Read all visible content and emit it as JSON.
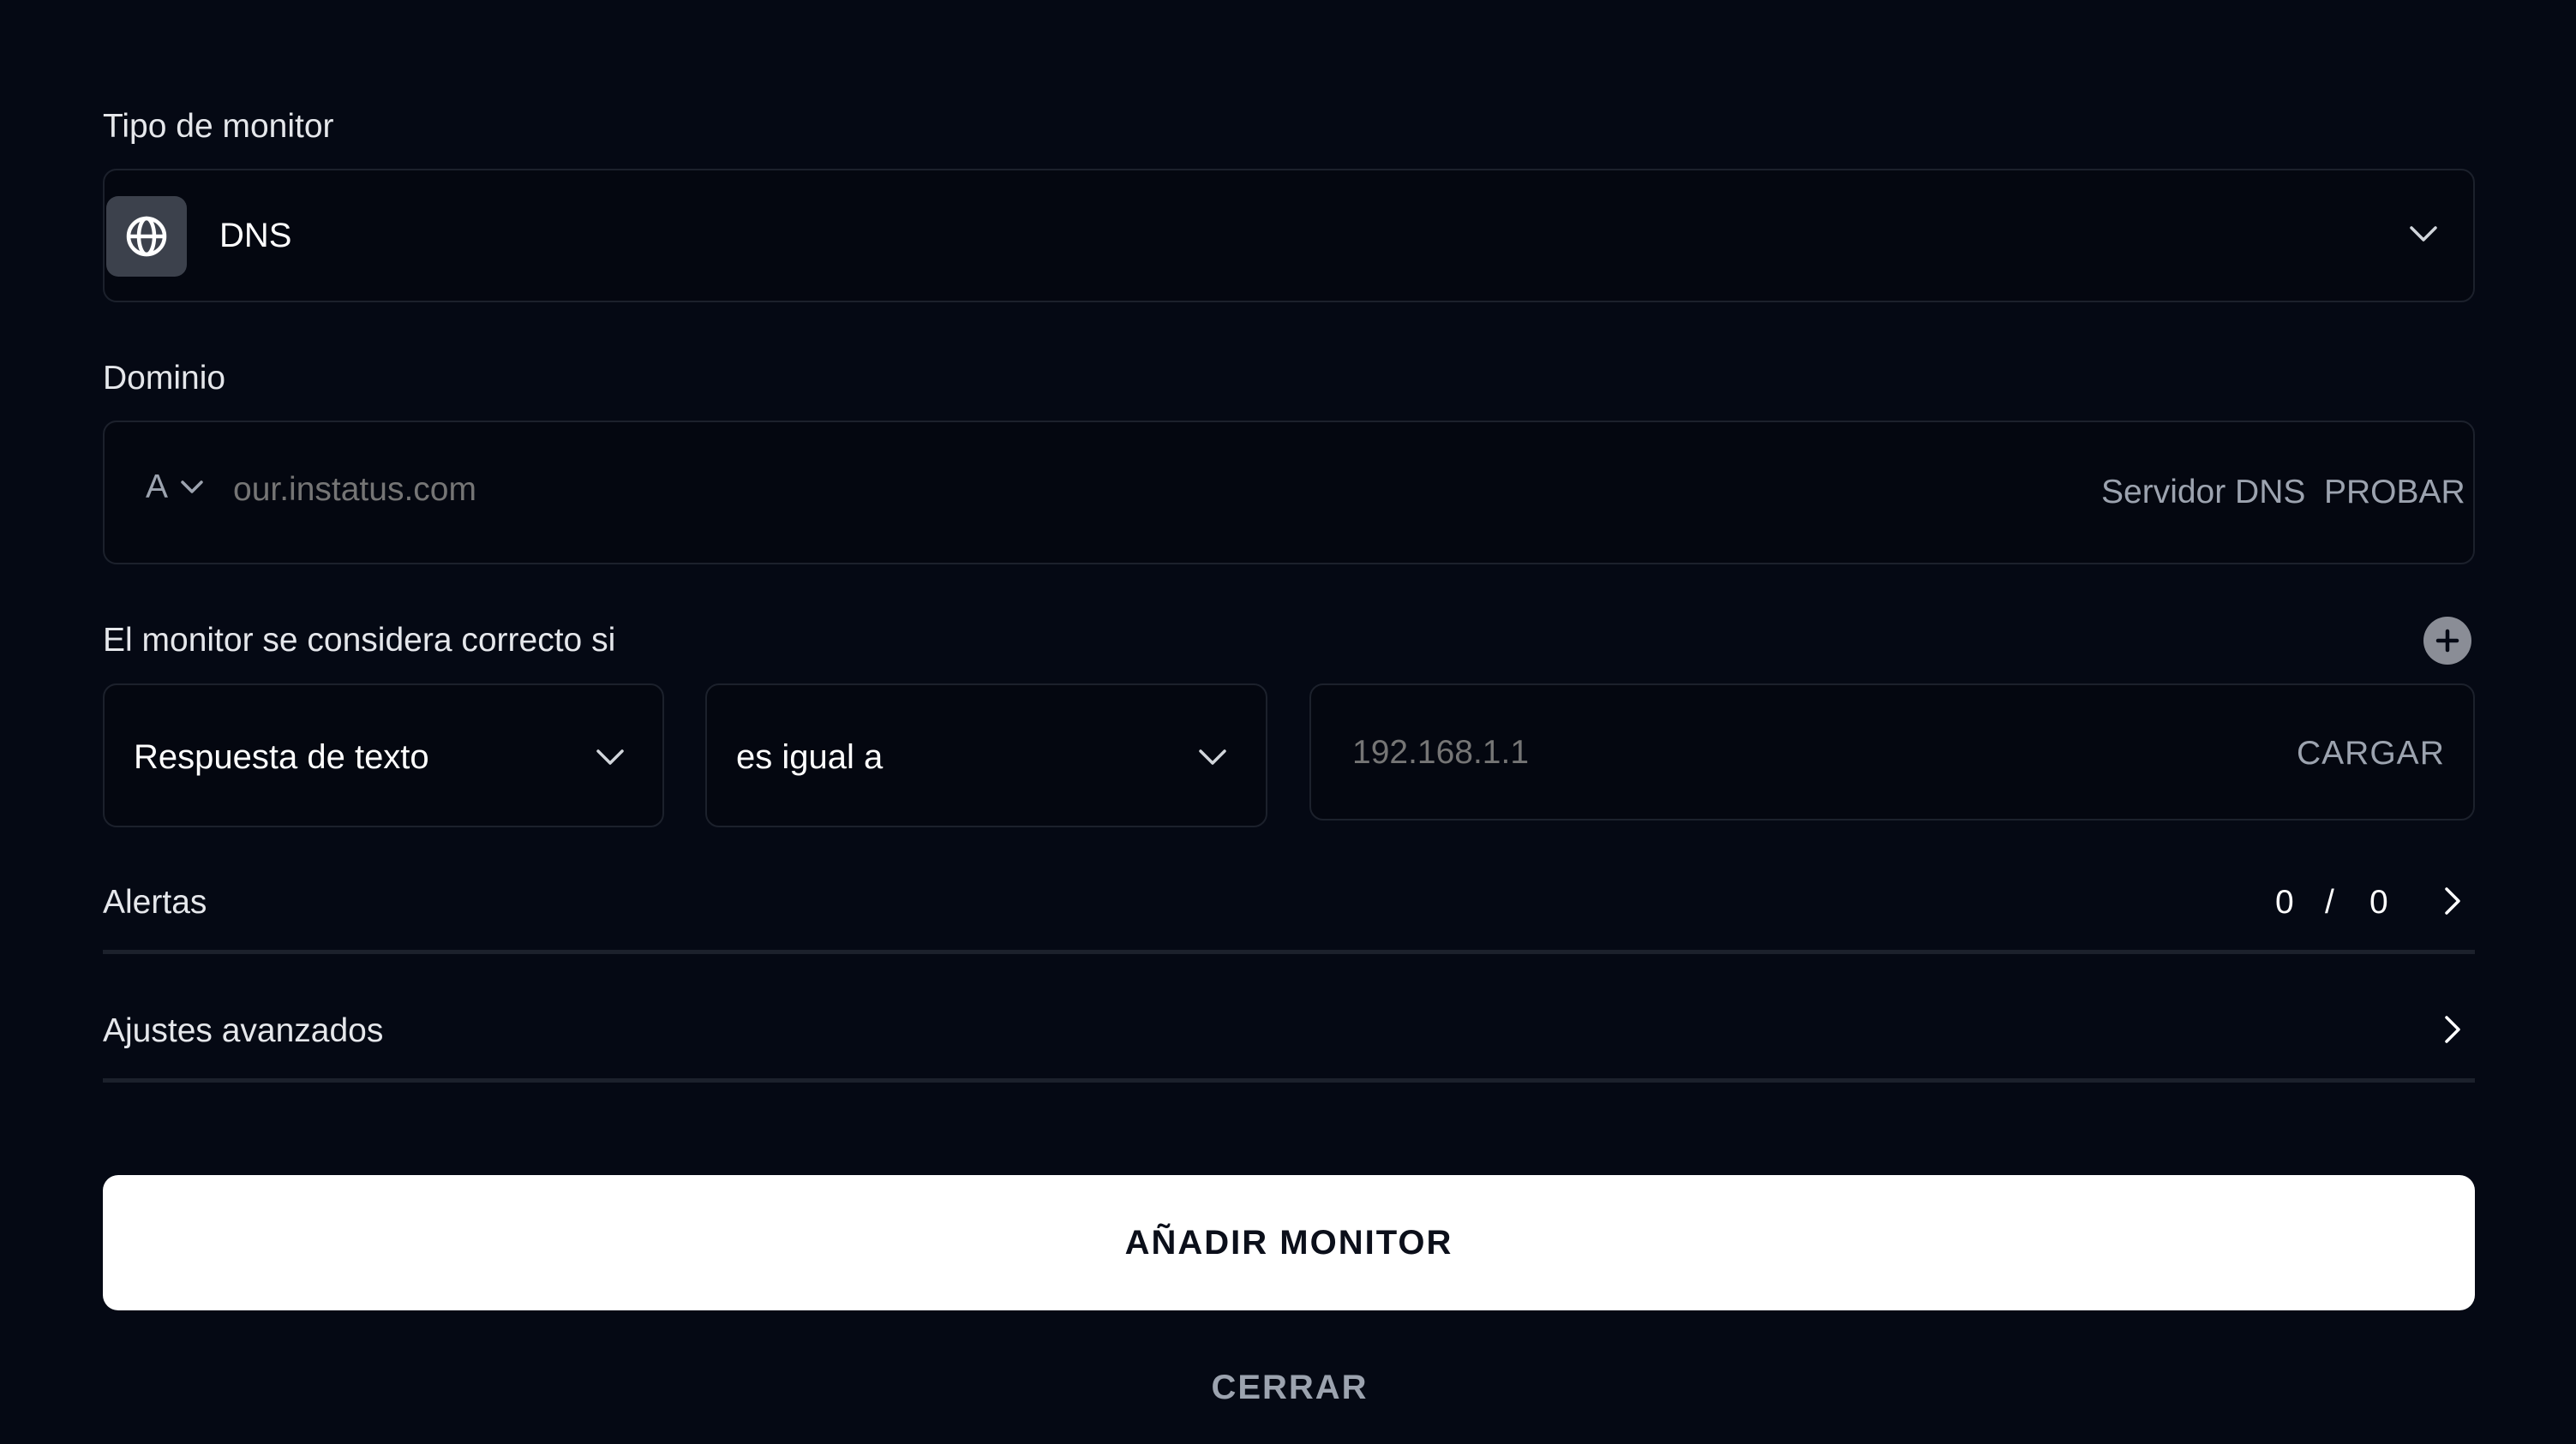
{
  "monitor_type": {
    "label": "Tipo de monitor",
    "value": "DNS",
    "icon": "globe-icon"
  },
  "domain": {
    "label": "Dominio",
    "record_type": "A",
    "placeholder": "our.instatus.com",
    "dns_server_label": "Servidor DNS",
    "test_label": "PROBAR"
  },
  "condition": {
    "label": "El monitor se considera correcto si",
    "field": "Respuesta de texto",
    "operator": "es igual a",
    "value_placeholder": "192.168.1.1",
    "load_label": "CARGAR"
  },
  "alerts": {
    "label": "Alertas",
    "count_a": "0",
    "separator": "/",
    "count_b": "0"
  },
  "advanced": {
    "label": "Ajustes avanzados"
  },
  "actions": {
    "add_label": "AÑADIR MONITOR",
    "close_label": "CERRAR"
  },
  "colors": {
    "background": "#050914",
    "border": "#1c212c",
    "primary_button": "#ffffff"
  }
}
